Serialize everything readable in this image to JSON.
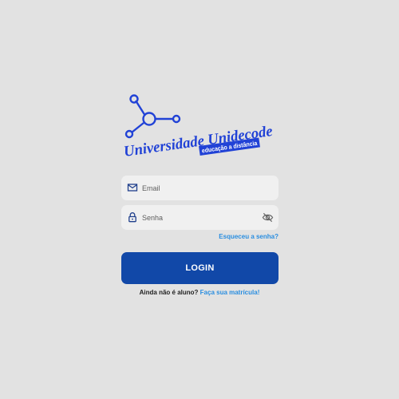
{
  "brand": {
    "name": "Universidade Unidecode",
    "tagline": "educação a distância",
    "colors": {
      "primary": "#1148a8",
      "logo": "#2142d6",
      "link": "#2a8ee0"
    }
  },
  "form": {
    "email": {
      "placeholder": "Email",
      "value": "",
      "icon": "mail-icon"
    },
    "password": {
      "placeholder": "Senha",
      "value": "",
      "icon": "lock-icon",
      "toggle_icon": "eye-off-icon"
    },
    "forgot_label": "Esqueceu a senha?",
    "login_label": "LOGIN"
  },
  "signup": {
    "prompt": "Ainda não é aluno?",
    "link_label": "Faça sua matrícula!"
  }
}
